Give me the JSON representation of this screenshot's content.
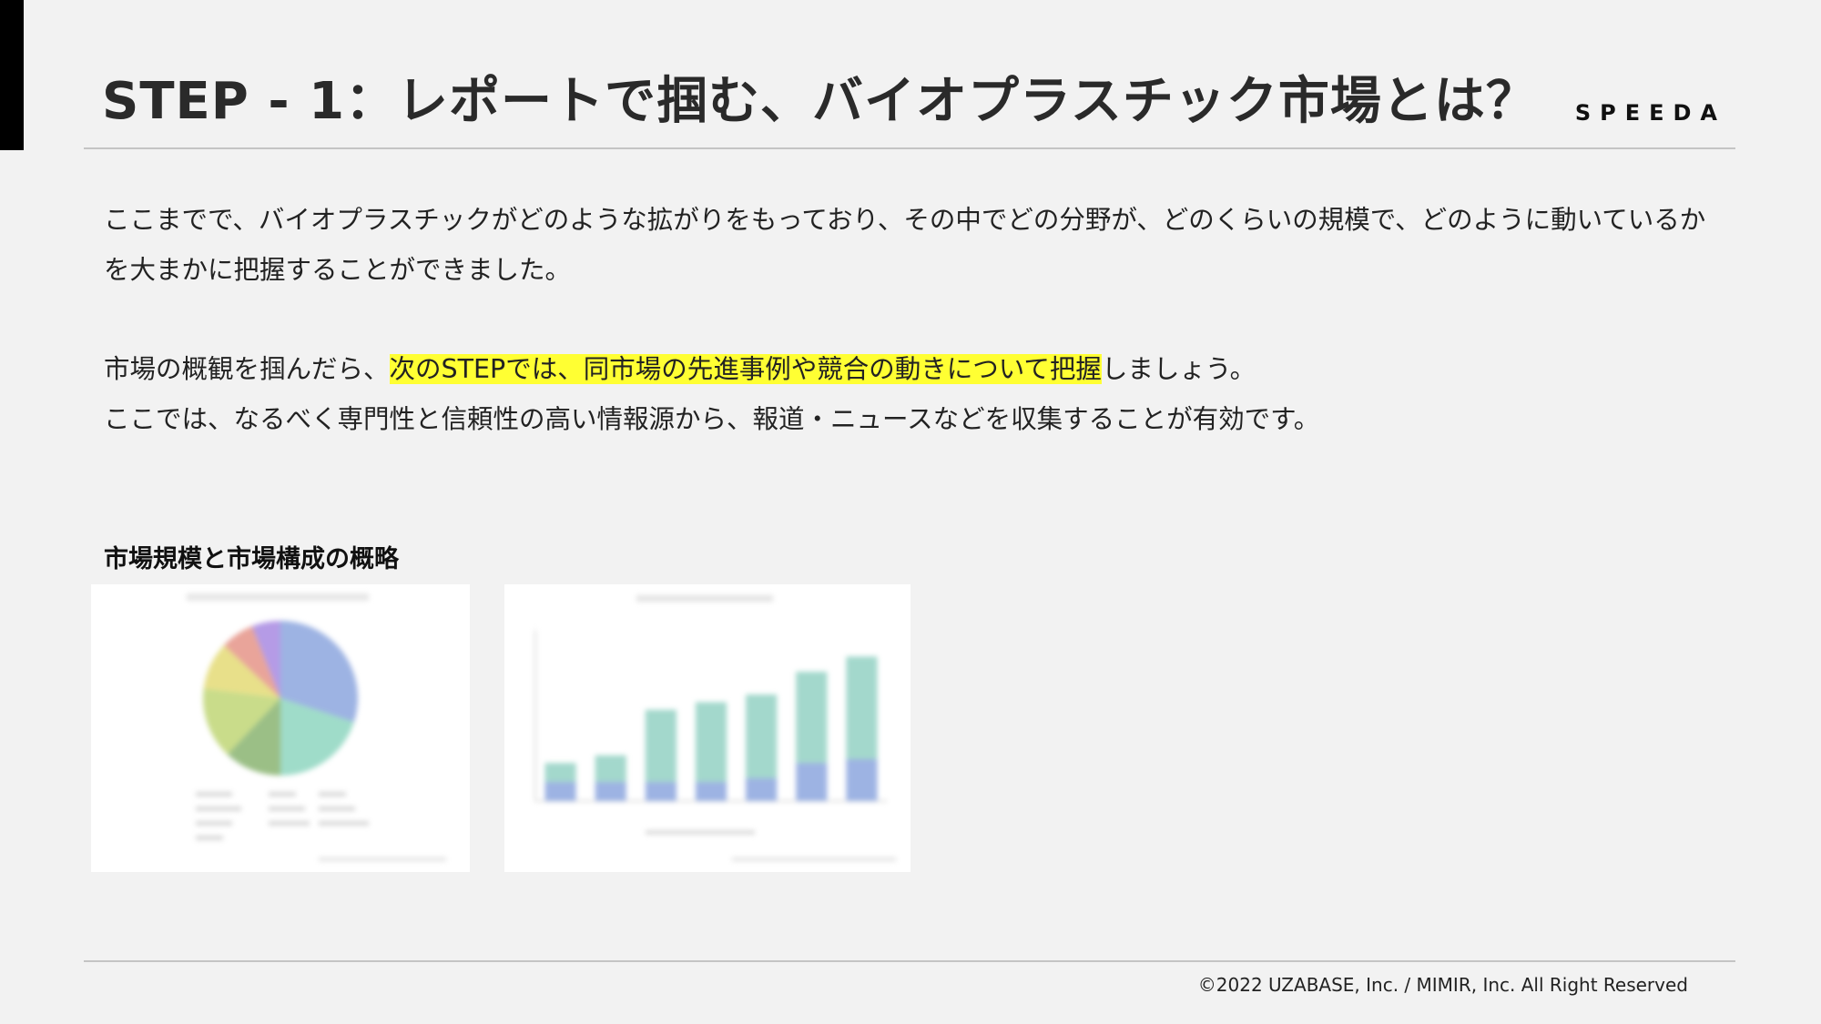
{
  "header": {
    "title": "STEP - 1：レポートで掴む、バイオプラスチック市場とは？",
    "brand": "SPEEDA"
  },
  "body": {
    "paragraph1": "ここまでで、バイオプラスチックがどのような拡がりをもっており、その中でどの分野が、どのくらいの規模で、どのように動いているかを大まかに把握することができました。",
    "paragraph2_before": "市場の概観を掴んだら、",
    "paragraph2_highlight": "次のSTEPでは、同市場の先進事例や競合の動きについて把握",
    "paragraph2_after": "しましょう。",
    "paragraph3": "ここでは、なるべく専門性と信頼性の高い情報源から、報道・ニュースなどを収集することが有効です。"
  },
  "section": {
    "label": "市場規模と市場構成の概略"
  },
  "chart_data": [
    {
      "type": "pie",
      "values": [
        30,
        20,
        12,
        15,
        10,
        7,
        6
      ],
      "colors": [
        "#9db3e3",
        "#9fdcc9",
        "#9bbf86",
        "#c9dc8a",
        "#e8e08a",
        "#e9a49a",
        "#b59be6"
      ]
    },
    {
      "type": "bar",
      "series": [
        {
          "values": [
            0.5,
            0.5,
            0.5,
            0.5,
            0.6,
            1.0,
            1.1
          ],
          "color": "#9db3e3"
        },
        {
          "values": [
            0.5,
            0.7,
            1.9,
            2.1,
            2.2,
            2.4,
            2.7
          ],
          "color": "#a3d8cc"
        }
      ],
      "ylim": [
        0,
        4.5
      ]
    }
  ],
  "footer": {
    "copyright": "©2022 UZABASE, Inc. / MIMIR, Inc. All Right Reserved"
  }
}
